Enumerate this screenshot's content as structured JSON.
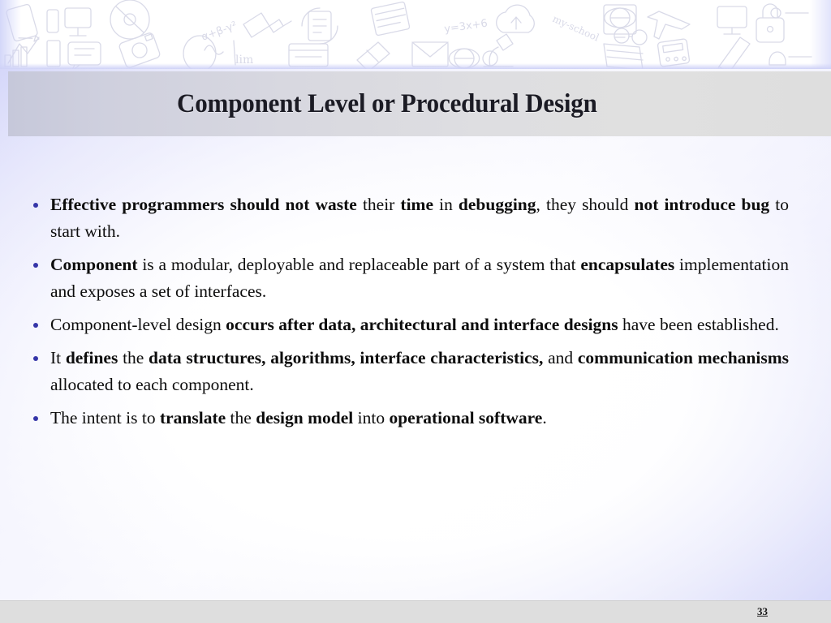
{
  "slide": {
    "title": "Component Level or Procedural Design",
    "page_number": "33",
    "bullet_color": "#3535a8",
    "title_banner_color": "#d8d8e0",
    "background_accent": "#c8cbf7",
    "bullets": [
      {
        "id": "bullet-effective-programmers",
        "runs": [
          {
            "text": "Effective programmers should not waste ",
            "bold": true
          },
          {
            "text": "their ",
            "bold": false
          },
          {
            "text": "time ",
            "bold": true
          },
          {
            "text": "in ",
            "bold": false
          },
          {
            "text": "debugging",
            "bold": true
          },
          {
            "text": ", they should ",
            "bold": false
          },
          {
            "text": "not introduce bug ",
            "bold": true
          },
          {
            "text": "to start with.",
            "bold": false
          }
        ]
      },
      {
        "id": "bullet-component-definition",
        "runs": [
          {
            "text": "Component ",
            "bold": true
          },
          {
            "text": "is a modular, deployable and replaceable part of a system that ",
            "bold": false
          },
          {
            "text": "encapsulates ",
            "bold": true
          },
          {
            "text": "implementation and exposes a set of interfaces.",
            "bold": false
          }
        ]
      },
      {
        "id": "bullet-component-level-design",
        "runs": [
          {
            "text": "Component-level design ",
            "bold": false
          },
          {
            "text": "occurs after data, architectural and interface designs ",
            "bold": true
          },
          {
            "text": "have been established.",
            "bold": false
          }
        ]
      },
      {
        "id": "bullet-it-defines",
        "runs": [
          {
            "text": "It ",
            "bold": false
          },
          {
            "text": "defines ",
            "bold": true
          },
          {
            "text": "the ",
            "bold": false
          },
          {
            "text": "data structures, algorithms, interface characteristics, ",
            "bold": true
          },
          {
            "text": "and ",
            "bold": false
          },
          {
            "text": "communication mechanisms ",
            "bold": true
          },
          {
            "text": "allocated to each component.",
            "bold": false
          }
        ]
      },
      {
        "id": "bullet-intent-translate",
        "runs": [
          {
            "text": "The intent is to ",
            "bold": false
          },
          {
            "text": "translate ",
            "bold": true
          },
          {
            "text": "the ",
            "bold": false
          },
          {
            "text": "design model ",
            "bold": true
          },
          {
            "text": "into ",
            "bold": false
          },
          {
            "text": "operational software",
            "bold": true
          },
          {
            "text": ".",
            "bold": false
          }
        ]
      }
    ],
    "decor": {
      "band_label": "hand-drawn technology doodle pattern",
      "icons": [
        "tablet-icon",
        "monitor-icon",
        "equation-alpha-beta-gamma-icon",
        "usb-drive-icon",
        "document-recycle-icon",
        "notebook-icon",
        "equation-y-3x-6-icon",
        "chart-growth-icon",
        "chat-lines-icon",
        "camera-icon",
        "mirror-icon",
        "limit-formula-icon",
        "window-icon",
        "eraser-icon",
        "calculator-icon",
        "pencil-icon",
        "cloud-upload-icon",
        "globe-grid-icon",
        "plane-icon",
        "desktop-icon",
        "envelope-icon",
        "microscope-icon",
        "glasses-books-icon",
        "padlock-icon"
      ]
    }
  }
}
